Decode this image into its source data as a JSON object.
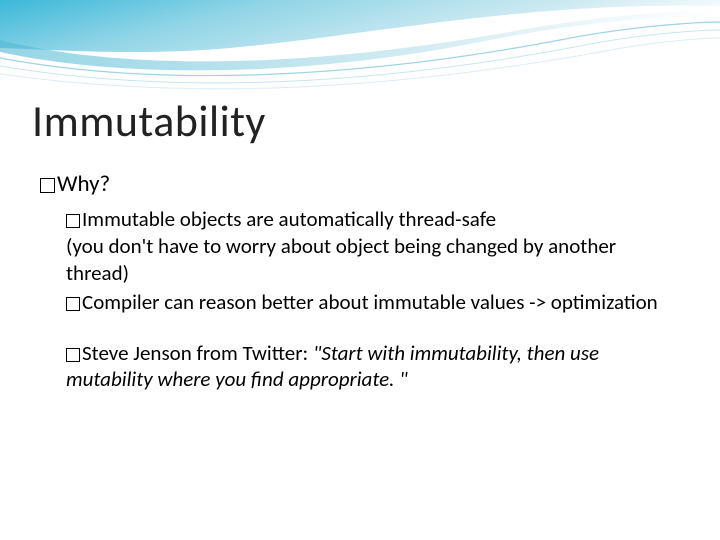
{
  "title": "Immutability",
  "lvl1": {
    "why": "Why?"
  },
  "pts": {
    "p1a": "Immutable objects are automatically thread-safe",
    "p1b": "(you don't have to worry about object being changed by another thread)",
    "p2": "Compiler can reason better about immutable values -> optimization",
    "p3a": "Steve Jenson from Twitter: ",
    "p3b": "\"Start with immutability, then use mutability where you find appropriate. \""
  }
}
